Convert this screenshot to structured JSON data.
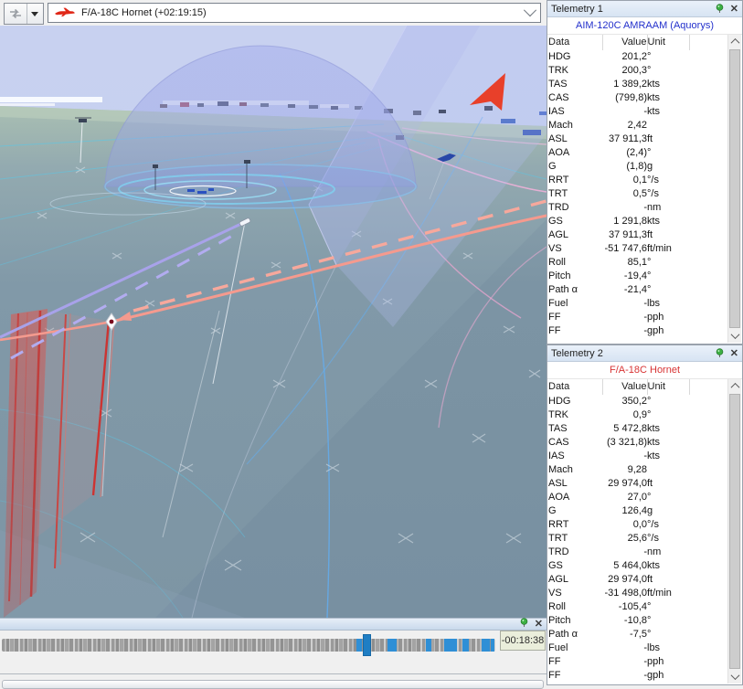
{
  "toolbar": {
    "object_selector_value": "F/A-18C Hornet (+02:19:15)"
  },
  "icons": {
    "close_glyph": "✕"
  },
  "colors": {
    "subtitle_blue": "#2330cc",
    "subtitle_red": "#d83434",
    "timeline_blue": "#2f8fd6",
    "trail_weapon": "#a8a2ea",
    "trail_ownship": "#f59a8e",
    "north_arrow_red": "#e8402a"
  },
  "panels": {
    "telemetry1": {
      "title": "Telemetry 1",
      "subtitle": "AIM-120C AMRAAM (Aquorys)",
      "subtitle_color": "#2330cc",
      "columns": [
        "Data",
        "Value",
        "Unit"
      ],
      "rows": [
        [
          "HDG",
          "201,2",
          "°"
        ],
        [
          "TRK",
          "200,3",
          "°"
        ],
        [
          "TAS",
          "1 389,2",
          "kts"
        ],
        [
          "CAS",
          "(799,8)",
          "kts"
        ],
        [
          "IAS",
          "-",
          "kts"
        ],
        [
          "Mach",
          "2,42",
          ""
        ],
        [
          "ASL",
          "37 911,3",
          "ft"
        ],
        [
          "AOA",
          "(2,4)",
          "°"
        ],
        [
          "G",
          "(1,8)",
          "g"
        ],
        [
          "RRT",
          "0,1",
          "°/s"
        ],
        [
          "TRT",
          "0,5",
          "°/s"
        ],
        [
          "TRD",
          "-",
          "nm"
        ],
        [
          "GS",
          "1 291,8",
          "kts"
        ],
        [
          "AGL",
          "37 911,3",
          "ft"
        ],
        [
          "VS",
          "-51 747,6",
          "ft/min"
        ],
        [
          "Roll",
          "85,1",
          "°"
        ],
        [
          "Pitch",
          "-19,4",
          "°"
        ],
        [
          "Path α",
          "-21,4",
          "°"
        ],
        [
          "Fuel",
          "-",
          "lbs"
        ],
        [
          "FF",
          "-",
          "pph"
        ],
        [
          "FF",
          "-",
          "gph"
        ]
      ]
    },
    "telemetry2": {
      "title": "Telemetry 2",
      "subtitle": "F/A-18C Hornet",
      "subtitle_color": "#d83434",
      "columns": [
        "Data",
        "Value",
        "Unit"
      ],
      "rows": [
        [
          "HDG",
          "350,2",
          "°"
        ],
        [
          "TRK",
          "0,9",
          "°"
        ],
        [
          "TAS",
          "5 472,8",
          "kts"
        ],
        [
          "CAS",
          "(3 321,8)",
          "kts"
        ],
        [
          "IAS",
          "-",
          "kts"
        ],
        [
          "Mach",
          "9,28",
          ""
        ],
        [
          "ASL",
          "29 974,0",
          "ft"
        ],
        [
          "AOA",
          "27,0",
          "°"
        ],
        [
          "G",
          "126,4",
          "g"
        ],
        [
          "RRT",
          "0,0",
          "°/s"
        ],
        [
          "TRT",
          "25,6",
          "°/s"
        ],
        [
          "TRD",
          "-",
          "nm"
        ],
        [
          "GS",
          "5 464,0",
          "kts"
        ],
        [
          "AGL",
          "29 974,0",
          "ft"
        ],
        [
          "VS",
          "-31 498,0",
          "ft/min"
        ],
        [
          "Roll",
          "-105,4",
          "°"
        ],
        [
          "Pitch",
          "-10,8",
          "°"
        ],
        [
          "Path α",
          "-7,5",
          "°"
        ],
        [
          "Fuel",
          "-",
          "lbs"
        ],
        [
          "FF",
          "-",
          "pph"
        ],
        [
          "FF",
          "-",
          "gph"
        ]
      ]
    }
  },
  "timeline": {
    "time_display": "-00:18:38",
    "cursor_percent": 73.2,
    "blue_segments": [
      [
        71.8,
        1.2
      ],
      [
        78.2,
        1.8
      ],
      [
        85.9,
        1.2
      ],
      [
        89.6,
        2.6
      ],
      [
        93.4,
        1.2
      ],
      [
        97.2,
        1.6
      ],
      [
        99.0,
        0.9
      ]
    ]
  }
}
